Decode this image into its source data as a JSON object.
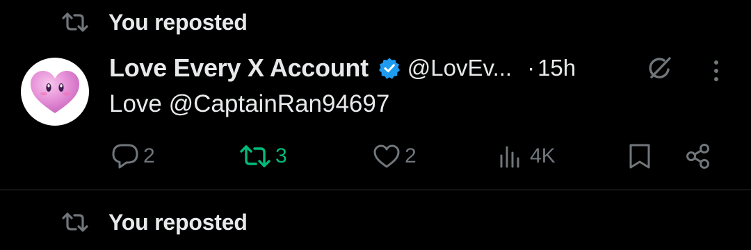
{
  "repost_banner": {
    "text": "You reposted"
  },
  "tweet": {
    "display_name": "Love Every X Account",
    "handle": "@LovEv...",
    "separator": "·",
    "time": "15h",
    "text": "Love @CaptainRan94697",
    "verified": true,
    "actions": {
      "replies": "2",
      "reposts": "3",
      "likes": "2",
      "views": "4K"
    },
    "reposted_by_user": true
  },
  "next_repost_banner": {
    "text": "You reposted"
  },
  "colors": {
    "background": "#000000",
    "text_primary": "#e7e9ea",
    "text_secondary": "#71767b",
    "verified_blue": "#1d9bf0",
    "repost_green": "#00ba7c",
    "divider": "#2f3336"
  },
  "icons": [
    "repost-icon",
    "verified-badge-icon",
    "grok-icon",
    "more-icon",
    "reply-icon",
    "like-icon",
    "views-icon",
    "bookmark-icon",
    "share-icon"
  ]
}
